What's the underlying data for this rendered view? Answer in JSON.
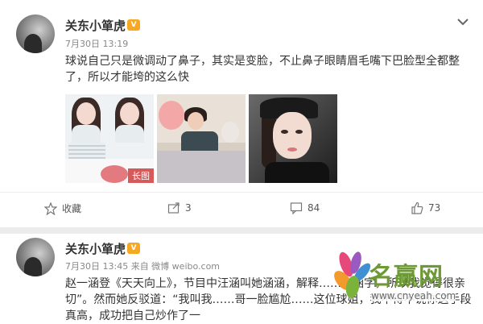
{
  "posts": [
    {
      "username": "关东小箪虎",
      "badge": "V",
      "meta": "7月30日 13:19",
      "text": "球说自己只是微调动了鼻子，其实是变脸，不止鼻子眼睛眉毛嘴下巴脸型全都整了，所以才能垮的这么快",
      "image_label": "长图",
      "actions": {
        "favorite": "收藏",
        "share": "3",
        "comment": "84",
        "like": "73"
      }
    },
    {
      "username": "关东小箪虎",
      "badge": "V",
      "meta": "7月30日 13:45 来自 微博 weibo.com",
      "text": "赵一涵登《天天向上》，节目中汪涵叫她涵涵，解释……个涵字，所以我觉得很亲切”。然而她反驳道：“我叫我……哥一脸尴尬……这位球姐，我不得不说你这手段真高，成功把自己炒作了一"
    }
  ],
  "watermark": {
    "title": "名赢网",
    "url": "www.cnyeah.com"
  },
  "colors": {
    "badge": "#f7a822",
    "watermark_green": "#6d9a34"
  }
}
